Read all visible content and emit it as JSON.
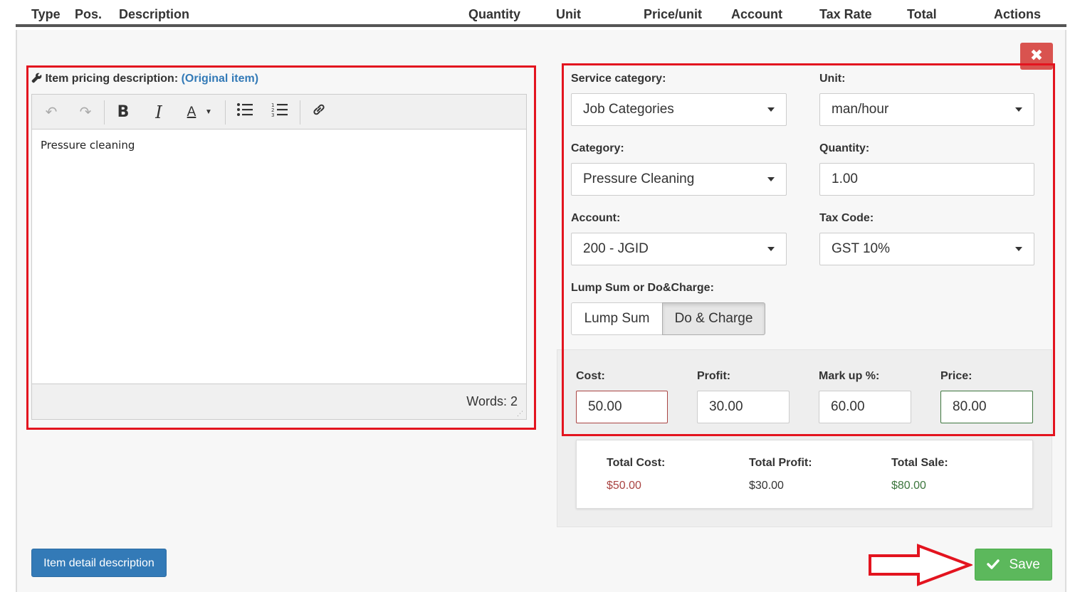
{
  "table_header": {
    "columns": [
      "Type",
      "Pos.",
      "Description",
      "Quantity",
      "Unit",
      "Price/unit",
      "Account",
      "Tax Rate",
      "Total",
      "Actions"
    ]
  },
  "close_button": {
    "symbol": "✖"
  },
  "editor": {
    "label": "Item pricing description:",
    "label_link": "(Original item)",
    "content": "Pressure cleaning",
    "word_count": "Words: 2"
  },
  "form": {
    "service_category": {
      "label": "Service category:",
      "value": "Job Categories"
    },
    "unit": {
      "label": "Unit:",
      "value": "man/hour"
    },
    "category": {
      "label": "Category:",
      "value": "Pressure Cleaning"
    },
    "quantity": {
      "label": "Quantity:",
      "value": "1.00"
    },
    "account": {
      "label": "Account:",
      "value": "200 - JGID"
    },
    "tax_code": {
      "label": "Tax Code:",
      "value": "GST 10%"
    },
    "charge_type": {
      "label": "Lump Sum or Do&Charge:",
      "options": [
        "Lump Sum",
        "Do & Charge"
      ],
      "selected": "Do & Charge"
    }
  },
  "pricing": {
    "cost": {
      "label": "Cost:",
      "value": "50.00"
    },
    "profit": {
      "label": "Profit:",
      "value": "30.00"
    },
    "markup": {
      "label": "Mark up %:",
      "value": "60.00"
    },
    "price": {
      "label": "Price:",
      "value": "80.00"
    }
  },
  "totals": {
    "total_cost": {
      "label": "Total Cost:",
      "value": "$50.00"
    },
    "total_profit": {
      "label": "Total Profit:",
      "value": "$30.00"
    },
    "total_sale": {
      "label": "Total Sale:",
      "value": "$80.00"
    }
  },
  "buttons": {
    "item_detail": "Item detail description",
    "save": "Save"
  },
  "colors": {
    "annotation": "#e3141f",
    "primary": "#337ab7",
    "success": "#5cb85c",
    "danger": "#d9534f"
  }
}
